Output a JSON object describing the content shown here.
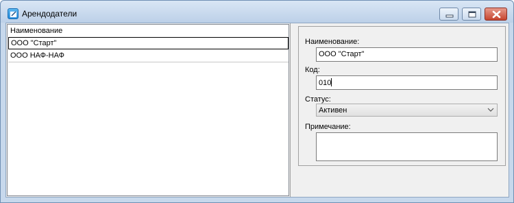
{
  "window": {
    "title": "Арендодатели",
    "icon": "notepad-app-icon"
  },
  "list": {
    "header": "Наименование",
    "rows": [
      "ООО \"Старт\"",
      "ООО НАФ-НАФ"
    ],
    "selected_index": 0
  },
  "form": {
    "name_label": "Наименование:",
    "name_value": "ООО \"Старт\"",
    "code_label": "Код:",
    "code_value": "010",
    "status_label": "Статус:",
    "status_value": "Активен",
    "note_label": "Примечание:",
    "note_value": ""
  }
}
